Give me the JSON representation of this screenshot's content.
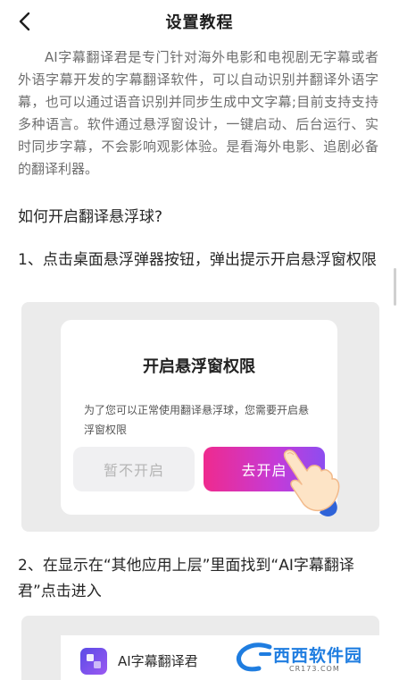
{
  "header": {
    "title": "设置教程",
    "back_icon": "chevron-left-icon"
  },
  "intro": "AI字幕翻译君是专门针对海外电影和电视剧无字幕或者外语字幕开发的字幕翻译软件，可以自动识别并翻译外语字幕，也可以通过语音识别并同步生成中文字幕;目前支持支持多种语言。软件通过悬浮窗设计，一键启动、后台运行、实时同步字幕，不会影响观影体验。是看海外电影、追剧必备的翻译利器。",
  "question_heading": "如何开启翻译悬浮球?",
  "step1": {
    "text": "1、点击桌面悬浮弹器按钮，弹出提示开启悬浮窗权限",
    "dialog": {
      "title": "开启悬浮窗权限",
      "message": "为了您可以正常使用翻译悬浮球，您需要开启悬浮窗权限",
      "cancel_label": "暂不开启",
      "confirm_label": "去开启",
      "pointer_icon": "hand-pointer-icon"
    }
  },
  "step2": {
    "text": "2、在显示在“其他应用上层”里面找到“AI字幕翻译君”点击进入",
    "app_item": {
      "name": "AI字幕翻译君",
      "icon_sub": "AI字幕翻译"
    }
  },
  "watermark": {
    "text": "西西软件园",
    "sub": "CR173.COM"
  },
  "colors": {
    "accent_gradient_start": "#ef2a8e",
    "accent_gradient_end": "#8d4df0",
    "watermark_blue": "#1f7de0"
  }
}
